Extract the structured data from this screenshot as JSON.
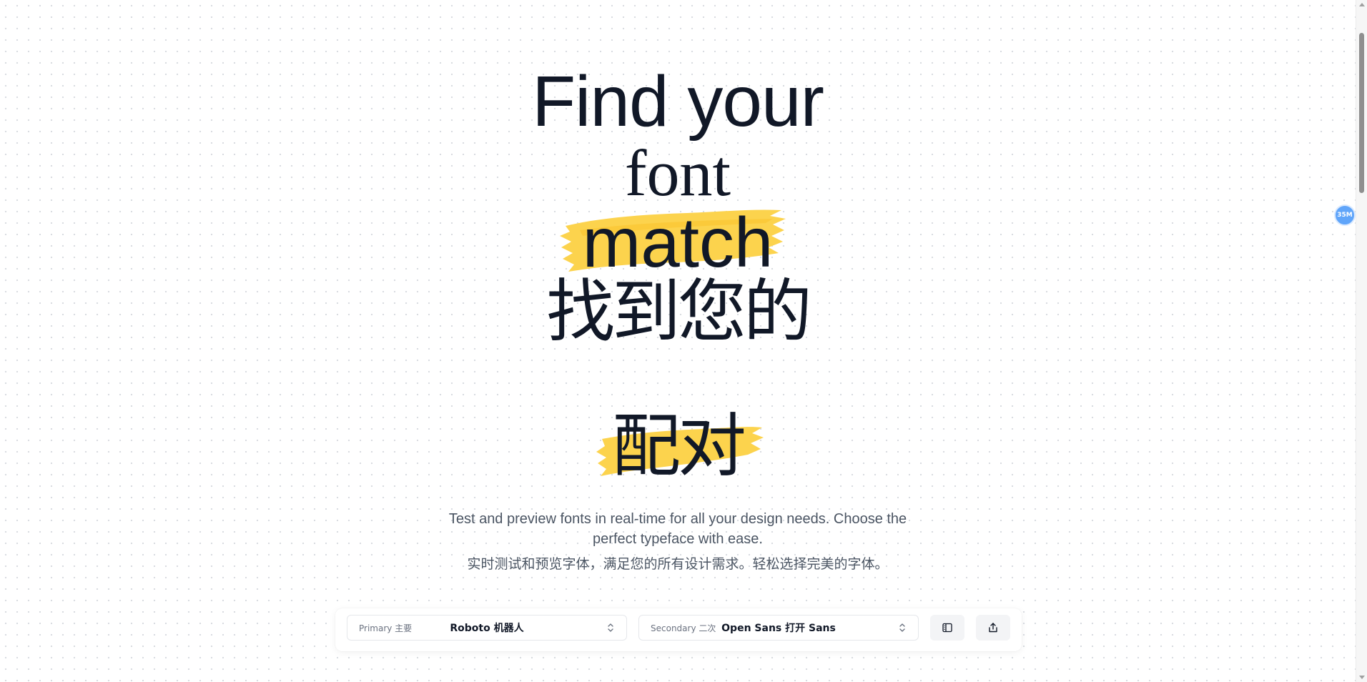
{
  "hero": {
    "line1": "Find your",
    "line2": "font",
    "line3": "match",
    "line4": "找到您的",
    "line5": "配对"
  },
  "description": {
    "en": "Test and preview fonts in real-time for all your design needs. Choose the perfect typeface with ease.",
    "zh": "实时测试和预览字体，满足您的所有设计需求。轻松选择完美的字体。"
  },
  "toolbar": {
    "primary": {
      "label": "Primary  主要",
      "value": "Roboto  机器人",
      "icon": "chevron-up-down-icon"
    },
    "secondary": {
      "label": "Secondary  二次",
      "value": "Open Sans  打开 Sans",
      "icon": "chevron-up-down-icon"
    },
    "layout_button_icon": "layout-columns-icon",
    "share_button_icon": "share-icon"
  },
  "badge": {
    "text": "35M"
  },
  "colors": {
    "highlight": "#fcd34d",
    "text": "#111827",
    "muted": "#4b5563",
    "badge": "#60a5fa"
  }
}
